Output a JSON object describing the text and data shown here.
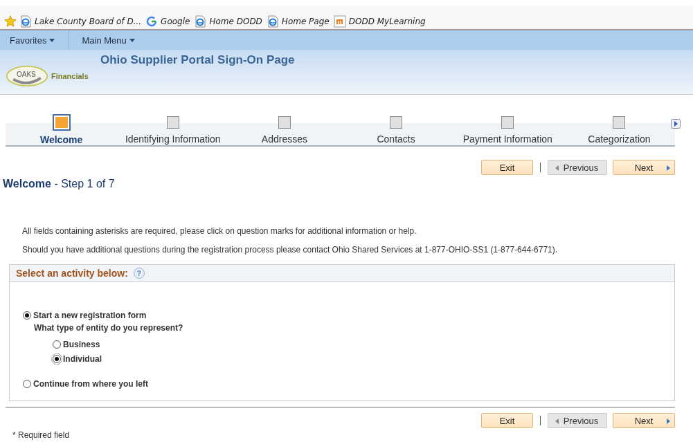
{
  "bookmarks": [
    {
      "label": "Lake County Board of D...",
      "kind": "ie"
    },
    {
      "label": "Google",
      "kind": "google"
    },
    {
      "label": "Home DODD",
      "kind": "ie"
    },
    {
      "label": "Home Page",
      "kind": "ie"
    },
    {
      "label": "DODD MyLearning",
      "kind": "m"
    }
  ],
  "menu": [
    {
      "label": "Favorites"
    },
    {
      "label": "Main Menu"
    }
  ],
  "header": {
    "title": "Ohio Supplier Portal Sign-On Page",
    "logo_text": "OAKS",
    "logo_caption": "Financials"
  },
  "steps": [
    {
      "label": "Welcome",
      "selected": true
    },
    {
      "label": "Identifying Information",
      "selected": false
    },
    {
      "label": "Addresses",
      "selected": false
    },
    {
      "label": "Contacts",
      "selected": false
    },
    {
      "label": "Payment Information",
      "selected": false
    },
    {
      "label": "Categorization",
      "selected": false
    }
  ],
  "nav_top": {
    "exit": "Exit",
    "previous": {
      "label": "Previous",
      "disabled": true
    },
    "next": "Next"
  },
  "page_title": {
    "main": "Welcome",
    "sub": "- Step 1 of 7"
  },
  "instructions": [
    "All fields containing asterisks are required, please click on question marks for additional information or help.",
    "Should you have additional questions during the registration process please contact Ohio Shared Services at 1-877-OHIO-SS1 (1-877-644-6771)."
  ],
  "activity": {
    "heading": "Select an activity below:",
    "help": "?",
    "options": [
      {
        "label": "Start a new registration form",
        "selected": true,
        "question": "What type of entity do you represent?",
        "children": [
          {
            "label": "Business",
            "selected": false
          },
          {
            "label": "Individual",
            "selected": true
          }
        ]
      },
      {
        "label": "Continue from where you left",
        "selected": false
      }
    ]
  },
  "nav_bottom": {
    "exit": "Exit",
    "previous": {
      "label": "Previous",
      "disabled": true
    },
    "next": "Next"
  },
  "footnote": "* Required field"
}
